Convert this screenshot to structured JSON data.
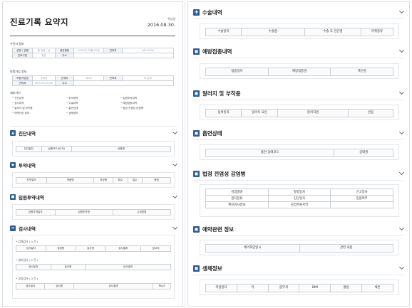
{
  "document": {
    "title": "진료기록 요약지",
    "issue_label": "작성일",
    "issue_date": "2016.08.30."
  },
  "patient_info": {
    "title": "수진자 정보",
    "rows": [
      [
        {
          "h": "성명 / 성별"
        },
        {
          "v": "홍 길동 / 남"
        },
        {
          "h": "생년월일"
        },
        {
          "v": "0000년 00월 00일"
        },
        {
          "h": "연락처"
        },
        {
          "v": "000-0000"
        }
      ],
      [
        {
          "h": "진료구분"
        },
        {
          "v": "일반"
        },
        {
          "h": "주소"
        },
        {
          "v": ""
        }
      ]
    ]
  },
  "guardian_info": {
    "title": "보험가입 정보",
    "rows": [
      [
        {
          "h": "보험가입명"
        },
        {
          "v": "우창훈"
        },
        {
          "h": "관계자"
        },
        {
          "v": "NDD"
        },
        {
          "h": "연락처"
        },
        {
          "v": "미 분류"
        }
      ],
      [
        {
          "h": "연락처"
        },
        {
          "v": "000-000-0000"
        },
        {
          "h": "주소"
        },
        {
          "v": ""
        }
      ]
    ]
  },
  "contents": {
    "title": "세부가기",
    "items": [
      "진단내역",
      "투약내역",
      "입원투약내역",
      "검사내역",
      "수술내역",
      "예방접종내역",
      "알러지 및 부작용",
      "흡연상태",
      "법정 전염성 감염병",
      "예약관련 정보",
      "생체정보"
    ]
  },
  "left_sections": {
    "diagnosis": {
      "title": "진단내역",
      "icon": "diagnosis-icon",
      "headers": [
        "진단일자",
        "상병코드(KCD)",
        "상병명"
      ]
    },
    "medication": {
      "title": "투약내역",
      "icon": "pill-icon",
      "headers": [
        "투약일자",
        "약품명",
        "처방량",
        "횟수",
        "일수",
        "용법"
      ]
    },
    "inpatient_medication": {
      "title": "입원투약내역",
      "icon": "bed-icon",
      "headers": [
        "입원투약일자",
        "입원투약명",
        "수성방법"
      ]
    },
    "exams": {
      "title": "검사내역",
      "icon": "exam-icon",
      "groups": [
        {
          "label": "검체검사 ( 0 건 )",
          "headers": [
            "검사일자",
            "검체명",
            "검사명",
            "검사결과",
            "참고치"
          ]
        },
        {
          "label": "병리검사 ( 0 건 )",
          "headers": [
            "검사일자",
            "검사명",
            "검사결과"
          ]
        },
        {
          "label": "영상검사 ( 0 건 )",
          "headers": [
            "검사일자",
            "검사명",
            "검사결과",
            "PACS"
          ]
        }
      ]
    }
  },
  "right_sections": {
    "surgery": {
      "title": "수술내역",
      "icon": "surgery-icon",
      "headers": [
        "수술일자",
        "수술명",
        "수술 후 진단명",
        "마취종류"
      ]
    },
    "vaccination": {
      "title": "예방접종내역",
      "icon": "syringe-icon",
      "headers": [
        "접종일자",
        "예방접종명",
        "백신명"
      ]
    },
    "allergy": {
      "title": "알러지 및 부작용",
      "icon": "allergy-icon",
      "headers": [
        "등록일자",
        "알러지 요인",
        "알러지명",
        "반응"
      ]
    },
    "smoking": {
      "title": "흡연상태",
      "icon": "smoking-icon",
      "headers": [
        "흡연 상태코드",
        "상태명"
      ]
    },
    "infectious": {
      "title": "법정 전염성 감염병",
      "icon": "infection-icon",
      "rows": [
        [
          "감염병명",
          "발병일자",
          "신고일자"
        ],
        [
          "원처분류",
          "진단일자",
          "입원여부"
        ],
        [
          "확진검사결과",
          "감염주원지역",
          ""
        ]
      ]
    },
    "reservation": {
      "title": "예약관련 정보",
      "icon": "calendar-icon",
      "headers": [
        "예약희망일시",
        "관련 내용"
      ]
    },
    "vitals": {
      "title": "생체정보",
      "icon": "vitals-icon",
      "headers": [
        "측정일자",
        "키",
        "몸무게",
        "BMI",
        "혈압",
        "체온"
      ]
    }
  }
}
